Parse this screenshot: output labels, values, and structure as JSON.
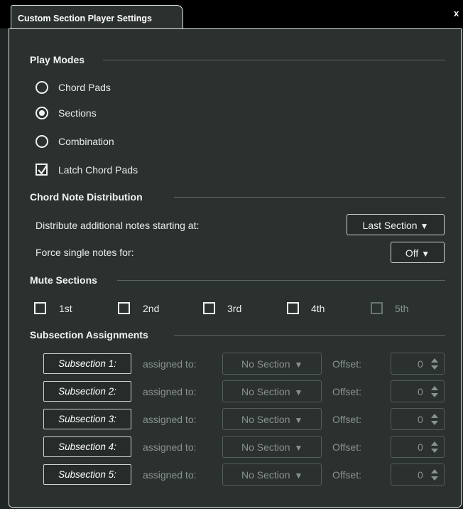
{
  "window": {
    "tab_title": "Custom Section Player Settings",
    "close_glyph": "x"
  },
  "play_modes": {
    "header": "Play Modes",
    "options": [
      "Chord Pads",
      "Sections",
      "Combination"
    ],
    "selected": "Sections",
    "latch_label": "Latch Chord Pads",
    "latch_checked": true
  },
  "chord_note_distribution": {
    "header": "Chord Note Distribution",
    "distribute_label": "Distribute additional notes starting at:",
    "distribute_value": "Last Section",
    "force_label": "Force single notes for:",
    "force_value": "Off"
  },
  "mute_sections": {
    "header": "Mute Sections",
    "items": [
      {
        "label": "1st",
        "checked": false,
        "enabled": true
      },
      {
        "label": "2nd",
        "checked": false,
        "enabled": true
      },
      {
        "label": "3rd",
        "checked": false,
        "enabled": true
      },
      {
        "label": "4th",
        "checked": false,
        "enabled": true
      },
      {
        "label": "5th",
        "checked": false,
        "enabled": false
      }
    ]
  },
  "subsection_assignments": {
    "header": "Subsection Assignments",
    "assigned_label": "assigned to:",
    "offset_label": "Offset:",
    "rows": [
      {
        "name": "Subsection 1:",
        "section": "No Section",
        "offset": "0"
      },
      {
        "name": "Subsection 2:",
        "section": "No Section",
        "offset": "0"
      },
      {
        "name": "Subsection 3:",
        "section": "No Section",
        "offset": "0"
      },
      {
        "name": "Subsection 4:",
        "section": "No Section",
        "offset": "0"
      },
      {
        "name": "Subsection 5:",
        "section": "No Section",
        "offset": "0"
      }
    ]
  },
  "glyphs": {
    "dropdown_arrow": "▼"
  },
  "colors": {
    "panel_bg": "#2b312f",
    "tab_strip": "#000000",
    "text": "#e9ecec",
    "disabled_text": "#8a9290",
    "border": "#dfe3e3"
  }
}
